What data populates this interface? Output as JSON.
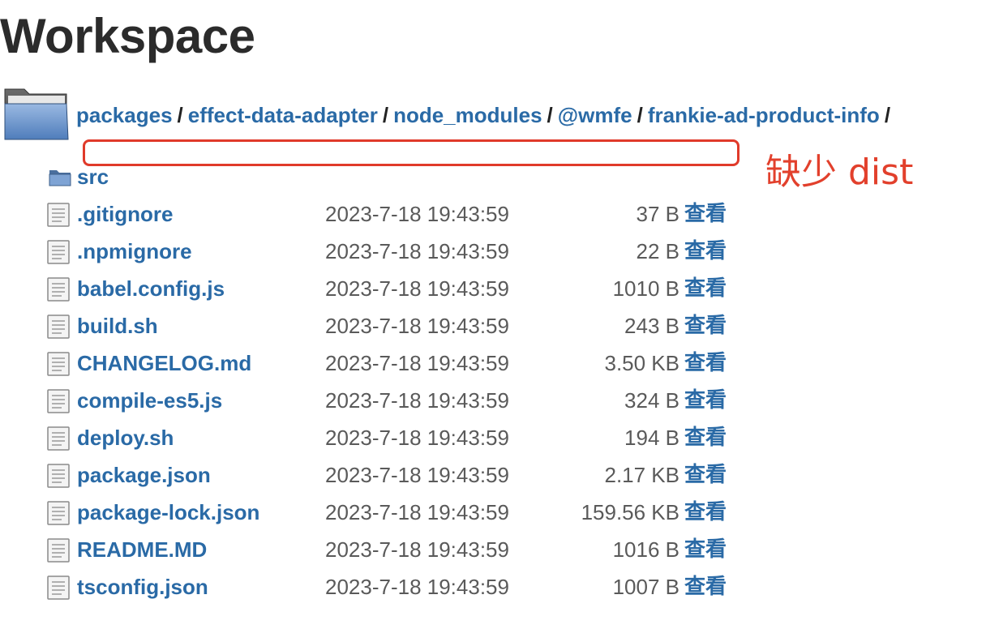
{
  "page": {
    "title": "Workspace"
  },
  "breadcrumb": {
    "items": [
      "packages",
      "effect-data-adapter",
      "node_modules",
      "@wmfe",
      "frankie-ad-product-info"
    ],
    "separator": "/"
  },
  "annotation": {
    "text": "缺少 dist",
    "color": "#e2402c"
  },
  "listing": {
    "directory": {
      "name": "src",
      "icon": "folder-icon"
    },
    "view_label": "查看",
    "files": [
      {
        "name": ".gitignore",
        "date": "2023-7-18 19:43:59",
        "size": "37 B"
      },
      {
        "name": ".npmignore",
        "date": "2023-7-18 19:43:59",
        "size": "22 B"
      },
      {
        "name": "babel.config.js",
        "date": "2023-7-18 19:43:59",
        "size": "1010 B"
      },
      {
        "name": "build.sh",
        "date": "2023-7-18 19:43:59",
        "size": "243 B"
      },
      {
        "name": "CHANGELOG.md",
        "date": "2023-7-18 19:43:59",
        "size": "3.50 KB"
      },
      {
        "name": "compile-es5.js",
        "date": "2023-7-18 19:43:59",
        "size": "324 B"
      },
      {
        "name": "deploy.sh",
        "date": "2023-7-18 19:43:59",
        "size": "194 B"
      },
      {
        "name": "package.json",
        "date": "2023-7-18 19:43:59",
        "size": "2.17 KB"
      },
      {
        "name": "package-lock.json",
        "date": "2023-7-18 19:43:59",
        "size": "159.56 KB"
      },
      {
        "name": "README.MD",
        "date": "2023-7-18 19:43:59",
        "size": "1016 B"
      },
      {
        "name": "tsconfig.json",
        "date": "2023-7-18 19:43:59",
        "size": "1007 B"
      }
    ]
  },
  "colors": {
    "link": "#2a6aa6",
    "text": "#2b2b2b",
    "muted": "#5a5a5a",
    "annotation": "#e03a2a"
  }
}
